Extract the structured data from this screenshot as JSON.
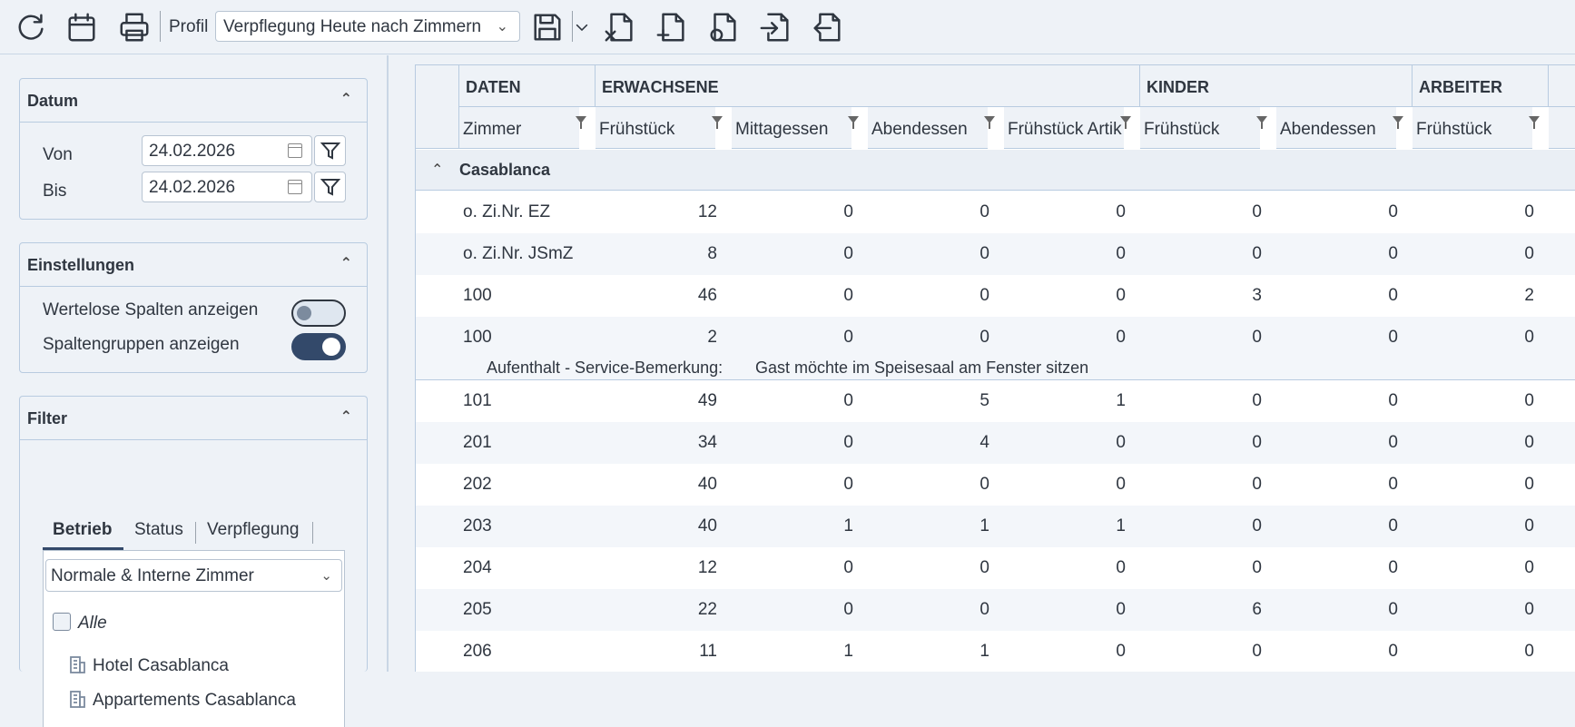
{
  "toolbar": {
    "profil_label": "Profil",
    "profil_value": "Verpflegung Heute nach Zimmern"
  },
  "datum": {
    "title": "Datum",
    "von_label": "Von",
    "von_value": "24.02.2026",
    "bis_label": "Bis",
    "bis_value": "24.02.2026"
  },
  "einstellungen": {
    "title": "Einstellungen",
    "wertelose_label": "Wertelose Spalten anzeigen",
    "wertelose_on": false,
    "spaltengruppen_label": "Spaltengruppen anzeigen",
    "spaltengruppen_on": true
  },
  "filter": {
    "title": "Filter",
    "tabs": [
      "Betrieb",
      "Status",
      "Verpflegung"
    ],
    "active_tab": "Betrieb",
    "select_value": "Normale & Interne Zimmer",
    "alle_label": "Alle",
    "items": [
      "Hotel Casablanca",
      "Appartements Casablanca"
    ]
  },
  "table": {
    "groups": [
      "DATEN",
      "ERWACHSENE",
      "KINDER",
      "ARBEITER"
    ],
    "columns": [
      "Zimmer",
      "Frühstück",
      "Mittagessen",
      "Abendessen",
      "Frühstück Artik",
      "Frühstück",
      "Abendessen",
      "Frühstück"
    ],
    "group_label": "Casablanca",
    "rows": [
      [
        "o. Zi.Nr. EZ",
        "12",
        "0",
        "0",
        "0",
        "0",
        "0",
        "0"
      ],
      [
        "o. Zi.Nr. JSmZ",
        "8",
        "0",
        "0",
        "0",
        "0",
        "0",
        "0"
      ],
      [
        "100",
        "46",
        "0",
        "0",
        "0",
        "3",
        "0",
        "2"
      ],
      [
        "100",
        "2",
        "0",
        "0",
        "0",
        "0",
        "0",
        "0"
      ],
      [
        "101",
        "49",
        "0",
        "5",
        "1",
        "0",
        "0",
        "0"
      ],
      [
        "201",
        "34",
        "0",
        "4",
        "0",
        "0",
        "0",
        "0"
      ],
      [
        "202",
        "40",
        "0",
        "0",
        "0",
        "0",
        "0",
        "0"
      ],
      [
        "203",
        "40",
        "1",
        "1",
        "1",
        "0",
        "0",
        "0"
      ],
      [
        "204",
        "12",
        "0",
        "0",
        "0",
        "0",
        "0",
        "0"
      ],
      [
        "205",
        "22",
        "0",
        "0",
        "0",
        "6",
        "0",
        "0"
      ],
      [
        "206",
        "11",
        "1",
        "1",
        "0",
        "0",
        "0",
        "0"
      ]
    ],
    "remark_label": "Aufenthalt - Service-Bemerkung:",
    "remark_text": "Gast möchte im Speisesaal am Fenster sitzen"
  },
  "icons": [
    "refresh-icon",
    "calendar-icon",
    "print-icon",
    "save-icon",
    "chevron-down-icon",
    "excel-export-icon",
    "add-file-icon",
    "file-settings-icon",
    "import-icon",
    "export-icon",
    "filter-icon",
    "building-icon",
    "chevron-up-icon"
  ]
}
